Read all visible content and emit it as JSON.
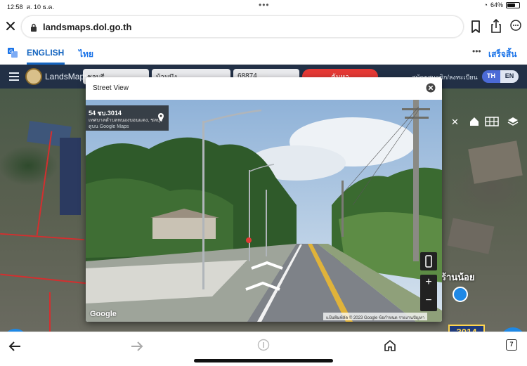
{
  "status": {
    "time": "12:58",
    "date": "ส. 10 ธ.ค.",
    "battery": "64%"
  },
  "browser": {
    "url": "landsmaps.dol.go.th"
  },
  "translate": {
    "english": "ENGLISH",
    "thai": "ไทย",
    "done": "เสร็จสิ้น"
  },
  "site": {
    "brand": "LandsMaps",
    "select1": "ชลบุรี",
    "select2": "บ้านบึง",
    "select3": "68874",
    "search_label": "ค้นหา",
    "register_text": "สมัครสมาชิก/ลงทะเบียน",
    "lang_th": "TH",
    "lang_en": "EN"
  },
  "map": {
    "place_label": "ร้านน้อย",
    "road_number": "3014",
    "fab_right": "•••"
  },
  "street_view": {
    "title": "Street View",
    "card_title": "54 ชบ.3014",
    "card_line2": "เทศบาลตำบลหนองบอนแดง, ชลบุรี",
    "card_line3": "ดูบน Google Maps",
    "google": "Google",
    "footer": "แป้นพิมพ์ลัด  © 2023 Google  ข้อกำหนด  รายงานปัญหา"
  },
  "bottombar": {
    "tabs_count": "7"
  },
  "icons": [
    "close-icon",
    "lock-icon",
    "bookmark-icon",
    "share-icon",
    "more-icon",
    "translate-icon",
    "hamburger-icon",
    "home-icon",
    "grid-icon",
    "layers-icon",
    "pin-icon",
    "phone-icon",
    "back-icon",
    "forward-icon",
    "home-nav-icon",
    "tabs-icon"
  ]
}
